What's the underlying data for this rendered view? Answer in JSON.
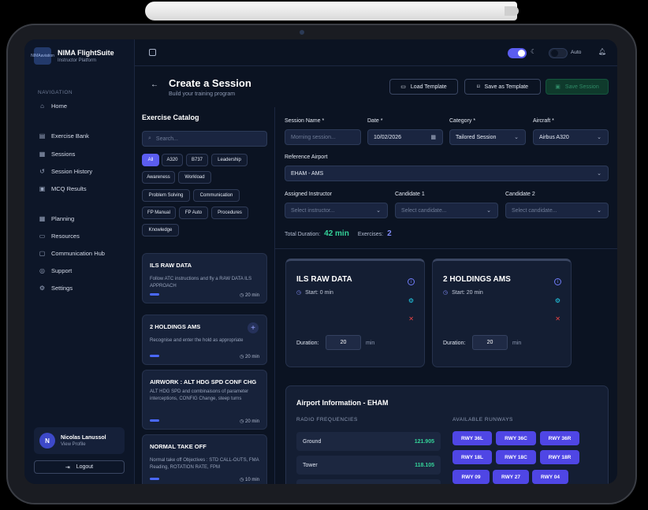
{
  "brand": {
    "logo_text": "NIMAaviation",
    "title": "NIMA FlightSuite",
    "subtitle": "Instructor Platform"
  },
  "nav": {
    "heading": "NAVIGATION",
    "items": [
      {
        "label": "Home",
        "icon": "home-icon"
      },
      {
        "label": "Exercise Bank",
        "icon": "book-icon"
      },
      {
        "label": "Sessions",
        "icon": "calendar-icon"
      },
      {
        "label": "Session History",
        "icon": "history-icon"
      },
      {
        "label": "MCQ Results",
        "icon": "clipboard-icon"
      },
      {
        "label": "Planning",
        "icon": "calendar-icon"
      },
      {
        "label": "Resources",
        "icon": "folder-icon"
      },
      {
        "label": "Communication Hub",
        "icon": "chat-icon"
      },
      {
        "label": "Support",
        "icon": "help-icon"
      },
      {
        "label": "Settings",
        "icon": "settings-icon"
      }
    ]
  },
  "user": {
    "initial": "N",
    "name": "Nicolas Lanussol",
    "link": "View Profile",
    "logout": "Logout"
  },
  "topbar": {
    "theme_auto": "Auto"
  },
  "header": {
    "title": "Create a Session",
    "subtitle": "Build your training program",
    "load_template": "Load Template",
    "save_template": "Save as Template",
    "save_session": "Save Session"
  },
  "catalog": {
    "title": "Exercise Catalog",
    "search_placeholder": "Search...",
    "filters": [
      "All",
      "A320",
      "B737",
      "Leadership",
      "Awareness",
      "Workload",
      "Problem Solving",
      "Communication",
      "FP Manual",
      "FP Auto",
      "Procedures",
      "Knowledge"
    ],
    "exercises": [
      {
        "title": "ILS RAW DATA",
        "desc": "Follow ATC instructions and fly a RAW DATA ILS APPROACH",
        "duration": "20 min"
      },
      {
        "title": "2 HOLDINGS AMS",
        "desc": "Recognise and enter the hold as appropriate",
        "duration": "20 min"
      },
      {
        "title": "AIRWORK : ALT HDG SPD CONF CHG",
        "desc": "ALT HDG SPD and combinaisons of parameter interceptions, CONFIG Change, steep turns",
        "duration": "20 min"
      },
      {
        "title": "NORMAL TAKE OFF",
        "desc": "Normal take off Objectives : STD CALL-OUTS, FMA Reading, ROTATION RATE, FPM",
        "duration": "10 min"
      }
    ]
  },
  "form": {
    "session_name_label": "Session Name *",
    "session_name_placeholder": "Morning session...",
    "date_label": "Date *",
    "date_value": "10/02/2026",
    "category_label": "Category *",
    "category_value": "Tailored Session",
    "aircraft_label": "Aircraft *",
    "aircraft_value": "Airbus A320",
    "airport_label": "Reference Airport",
    "airport_value": "EHAM - AMS",
    "instructor_label": "Assigned Instructor",
    "instructor_placeholder": "Select instructor...",
    "cand1_label": "Candidate 1",
    "cand1_placeholder": "Select candidate...",
    "cand2_label": "Candidate 2",
    "cand2_placeholder": "Select candidate...",
    "total_label": "Total Duration:",
    "total_value": "42 min",
    "exercises_label": "Exercises:",
    "exercises_value": "2"
  },
  "session_cards": [
    {
      "title": "ILS RAW DATA",
      "start": "Start: 0 min",
      "duration_label": "Duration:",
      "duration_value": "20",
      "unit": "min"
    },
    {
      "title": "2 HOLDINGS AMS",
      "start": "Start: 20 min",
      "duration_label": "Duration:",
      "duration_value": "20",
      "unit": "min"
    }
  ],
  "airport_info": {
    "title": "Airport Information - EHAM",
    "freq_heading": "RADIO FREQUENCIES",
    "frequencies": [
      {
        "name": "Ground",
        "value": "121.905"
      },
      {
        "name": "Tower",
        "value": "118.105"
      }
    ],
    "runway_heading": "AVAILABLE RUNWAYS",
    "runways": [
      "RWY 36L",
      "RWY 36C",
      "RWY 36R",
      "RWY 18L",
      "RWY 18C",
      "RWY 18R",
      "RWY 09",
      "RWY 27",
      "RWY 04"
    ]
  },
  "colors": {
    "accent": "#5b5df0",
    "success": "#34d399",
    "danger": "#ef4444",
    "background": "#0b1322"
  }
}
